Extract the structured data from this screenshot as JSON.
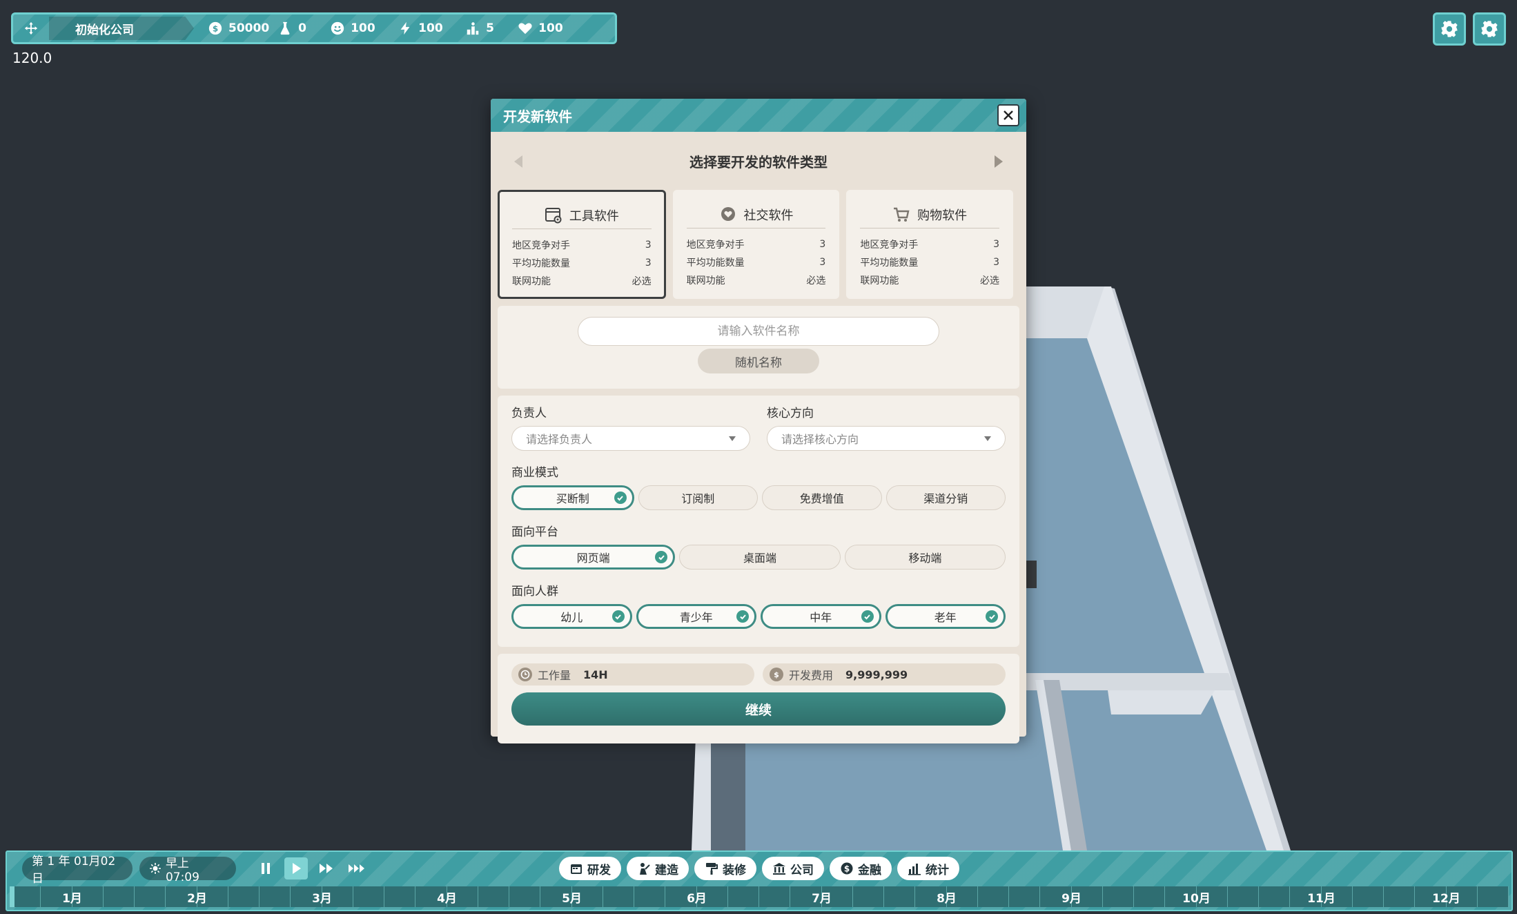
{
  "hud": {
    "company": "初始化公司",
    "money": "50000",
    "research": "0",
    "mood": "100",
    "energy": "100",
    "staff": "5",
    "health": "100"
  },
  "fps": "120.0",
  "dialog": {
    "title": "开发新软件",
    "type_heading": "选择要开发的软件类型",
    "types": [
      {
        "name": "工具软件",
        "icon": "tool-window-icon",
        "rows": [
          {
            "label": "地区竞争对手",
            "value": "3"
          },
          {
            "label": "平均功能数量",
            "value": "3"
          },
          {
            "label": "联网功能",
            "value": "必选"
          }
        ]
      },
      {
        "name": "社交软件",
        "icon": "chat-heart-icon",
        "rows": [
          {
            "label": "地区竞争对手",
            "value": "3"
          },
          {
            "label": "平均功能数量",
            "value": "3"
          },
          {
            "label": "联网功能",
            "value": "必选"
          }
        ]
      },
      {
        "name": "购物软件",
        "icon": "shopping-cart-icon",
        "rows": [
          {
            "label": "地区竞争对手",
            "value": "3"
          },
          {
            "label": "平均功能数量",
            "value": "3"
          },
          {
            "label": "联网功能",
            "value": "必选"
          }
        ]
      }
    ],
    "selected_type": "工具软件",
    "name_placeholder": "请输入软件名称",
    "random_name": "随机名称",
    "owner_label": "负责人",
    "owner_placeholder": "请选择负责人",
    "core_label": "核心方向",
    "core_placeholder": "请选择核心方向",
    "business_label": "商业模式",
    "business_options": [
      "买断制",
      "订阅制",
      "免费增值",
      "渠道分销"
    ],
    "business_selected": [
      "买断制"
    ],
    "platform_label": "面向平台",
    "platform_options": [
      "网页端",
      "桌面端",
      "移动端"
    ],
    "platform_selected": [
      "网页端"
    ],
    "audience_label": "面向人群",
    "audience_options": [
      "幼儿",
      "青少年",
      "中年",
      "老年"
    ],
    "audience_selected": [
      "幼儿",
      "青少年",
      "中年",
      "老年"
    ],
    "workload_label": "工作量",
    "workload_value": "14H",
    "cost_label": "开发费用",
    "cost_value": "9,999,999",
    "continue": "继续"
  },
  "bottom": {
    "date": "第 1 年  01月02日",
    "time": "早上 07:09",
    "nav": [
      {
        "label": "研发",
        "icon": "calendar-icon"
      },
      {
        "label": "建造",
        "icon": "worker-icon"
      },
      {
        "label": "装修",
        "icon": "paint-roller-icon"
      },
      {
        "label": "公司",
        "icon": "bank-icon"
      },
      {
        "label": "金融",
        "icon": "coin-icon"
      },
      {
        "label": "统计",
        "icon": "bar-chart-icon"
      }
    ],
    "months": [
      "1月",
      "2月",
      "3月",
      "4月",
      "5月",
      "6月",
      "7月",
      "8月",
      "9月",
      "10月",
      "11月",
      "12月"
    ],
    "year_progress": 0.003
  },
  "colors": {
    "accent": "#3f9ea3",
    "accent_border": "#6fd0d0",
    "dialog_bg": "#e9e1d7",
    "button": "#2f6f6b",
    "check": "#3e9c8c",
    "background": "#2b3138"
  }
}
